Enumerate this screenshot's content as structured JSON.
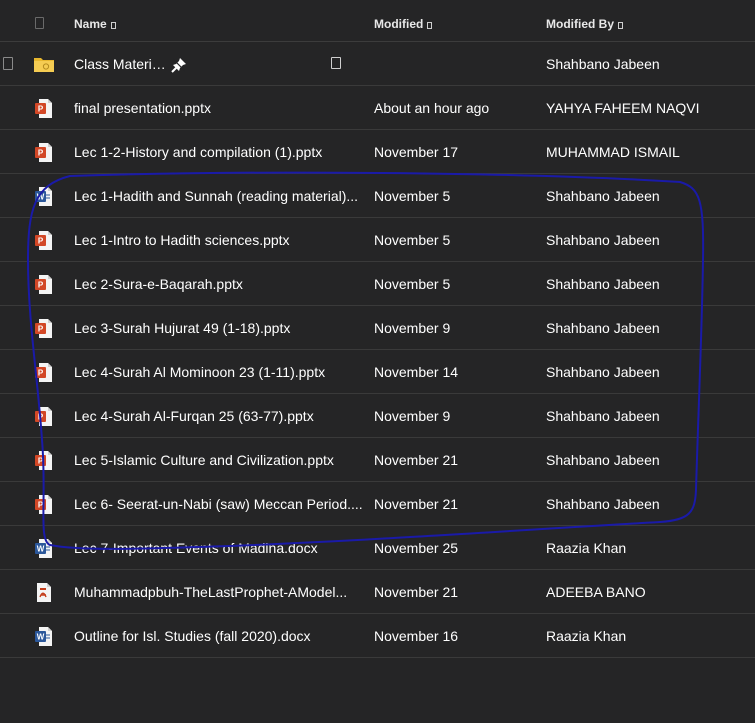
{
  "header": {
    "name_label": "Name",
    "modified_label": "Modified",
    "modified_by_label": "Modified By"
  },
  "colors": {
    "background": "#252526",
    "row_divider": "#3a3a3a",
    "powerpoint": "#d24726",
    "word": "#2b579a",
    "pdf": "#c43e1c",
    "folder": "#f0c23f",
    "annotation": "#1a1aa8"
  },
  "files": [
    {
      "type": "folder",
      "icon": "folder-icon",
      "name": "Class Materials",
      "modified": "",
      "modified_by": "Shahbano Jabeen"
    },
    {
      "type": "pptx",
      "icon": "powerpoint-file-icon",
      "name": "final presentation.pptx",
      "modified": "About an hour ago",
      "modified_by": "YAHYA FAHEEM NAQVI"
    },
    {
      "type": "pptx",
      "icon": "powerpoint-file-icon",
      "name": "Lec 1-2-History and compilation (1).pptx",
      "modified": "November 17",
      "modified_by": "MUHAMMAD ISMAIL"
    },
    {
      "type": "docx",
      "icon": "word-file-icon",
      "name": "Lec 1-Hadith and Sunnah (reading material)...",
      "modified": "November 5",
      "modified_by": "Shahbano Jabeen"
    },
    {
      "type": "pptx",
      "icon": "powerpoint-file-icon",
      "name": "Lec 1-Intro to Hadith sciences.pptx",
      "modified": "November 5",
      "modified_by": "Shahbano Jabeen"
    },
    {
      "type": "pptx",
      "icon": "powerpoint-file-icon",
      "name": "Lec 2-Sura-e-Baqarah.pptx",
      "modified": "November 5",
      "modified_by": "Shahbano Jabeen"
    },
    {
      "type": "pptx",
      "icon": "powerpoint-file-icon",
      "name": "Lec 3-Surah Hujurat 49 (1-18).pptx",
      "modified": "November 9",
      "modified_by": "Shahbano Jabeen"
    },
    {
      "type": "pptx",
      "icon": "powerpoint-file-icon",
      "name": "Lec 4-Surah Al Mominoon 23 (1-11).pptx",
      "modified": "November 14",
      "modified_by": "Shahbano Jabeen"
    },
    {
      "type": "pptx",
      "icon": "powerpoint-file-icon",
      "name": "Lec 4-Surah Al-Furqan 25 (63-77).pptx",
      "modified": "November 9",
      "modified_by": "Shahbano Jabeen"
    },
    {
      "type": "pptx",
      "icon": "powerpoint-file-icon",
      "name": "Lec 5-Islamic Culture and Civilization.pptx",
      "modified": "November 21",
      "modified_by": "Shahbano Jabeen"
    },
    {
      "type": "pptx",
      "icon": "powerpoint-file-icon",
      "name": "Lec 6- Seerat-un-Nabi (saw) Meccan Period....",
      "modified": "November 21",
      "modified_by": "Shahbano Jabeen"
    },
    {
      "type": "docx",
      "icon": "word-file-icon",
      "name": "Lec 7-Important Events of Madina.docx",
      "modified": "November 25",
      "modified_by": "Raazia Khan"
    },
    {
      "type": "pdf",
      "icon": "pdf-file-icon",
      "name": "Muhammadpbuh-TheLastProphet-AModel...",
      "modified": "November 21",
      "modified_by": "ADEEBA BANO"
    },
    {
      "type": "docx",
      "icon": "word-file-icon",
      "name": "Outline for Isl. Studies (fall 2020).docx",
      "modified": "November 16",
      "modified_by": "Raazia Khan"
    }
  ]
}
